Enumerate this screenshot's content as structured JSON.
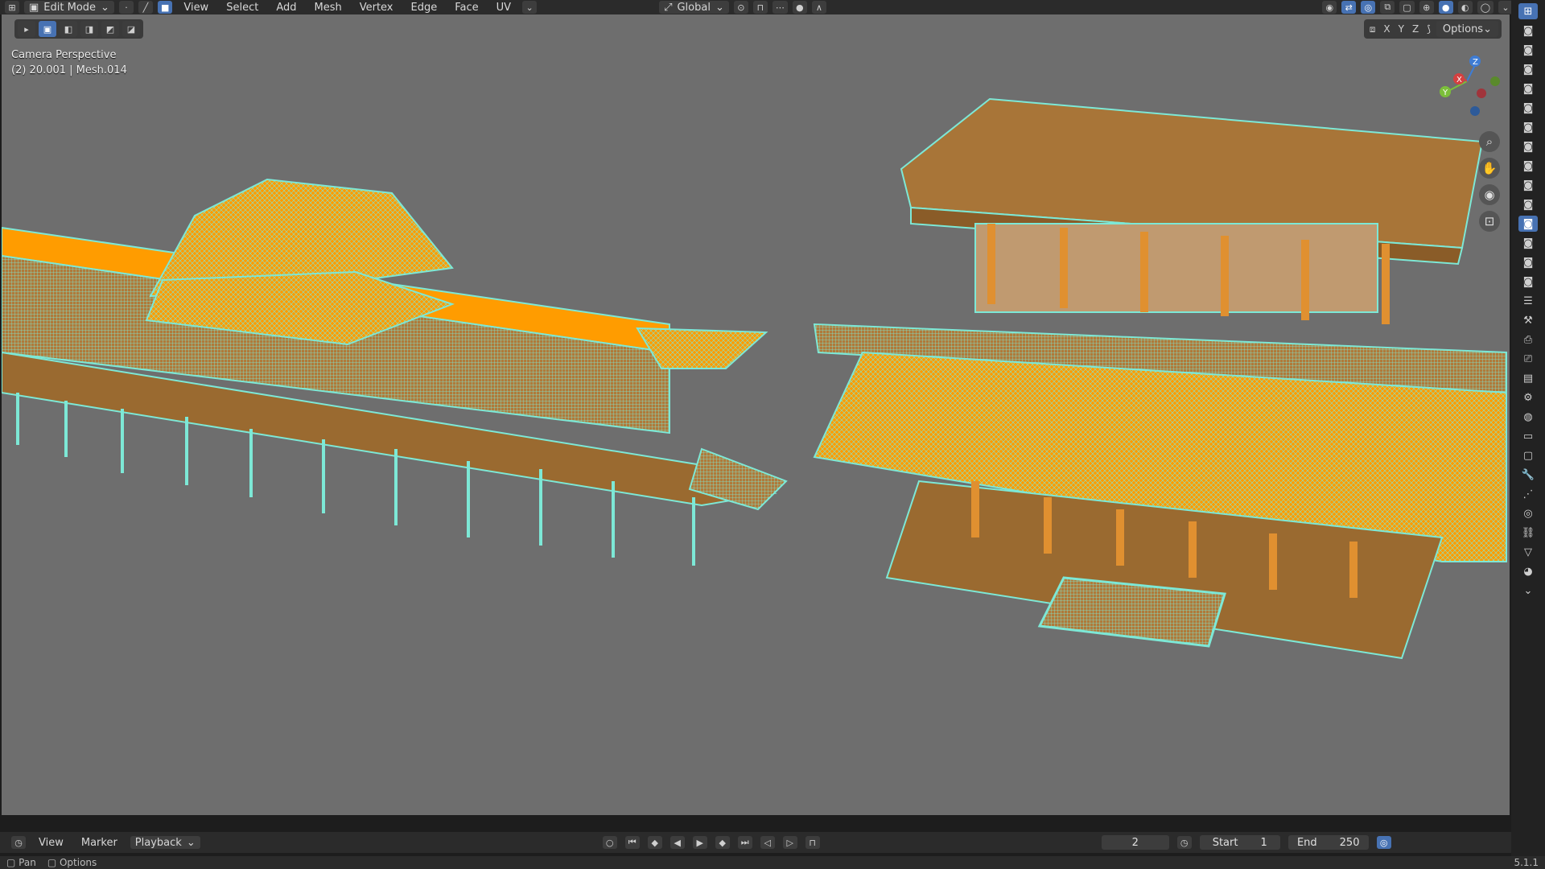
{
  "header": {
    "mode": "Edit Mode",
    "menus": [
      "View",
      "Select",
      "Add",
      "Mesh",
      "Vertex",
      "Edge",
      "Face",
      "UV"
    ],
    "orientation": "Global"
  },
  "viewport": {
    "view_label": "Camera Perspective",
    "object_info": "(2) 20.001 | Mesh.014",
    "axes": [
      "X",
      "Y",
      "Z"
    ],
    "options_label": "Options",
    "gizmo": {
      "x": "X",
      "y": "Y",
      "z": "Z"
    }
  },
  "timeline": {
    "menus": [
      "View",
      "Marker",
      "Playback"
    ],
    "current_frame": "2",
    "start_label": "Start",
    "start_value": "1",
    "end_label": "End",
    "end_value": "250"
  },
  "statusbar": {
    "items": [
      "Pan",
      "Options"
    ],
    "version": "5.1.1"
  },
  "colors": {
    "selected_face": "#ff9c00",
    "selected_wire": "#7de8d6",
    "viewport_bg": "#6e6e6e",
    "active_blue": "#4772b3"
  }
}
